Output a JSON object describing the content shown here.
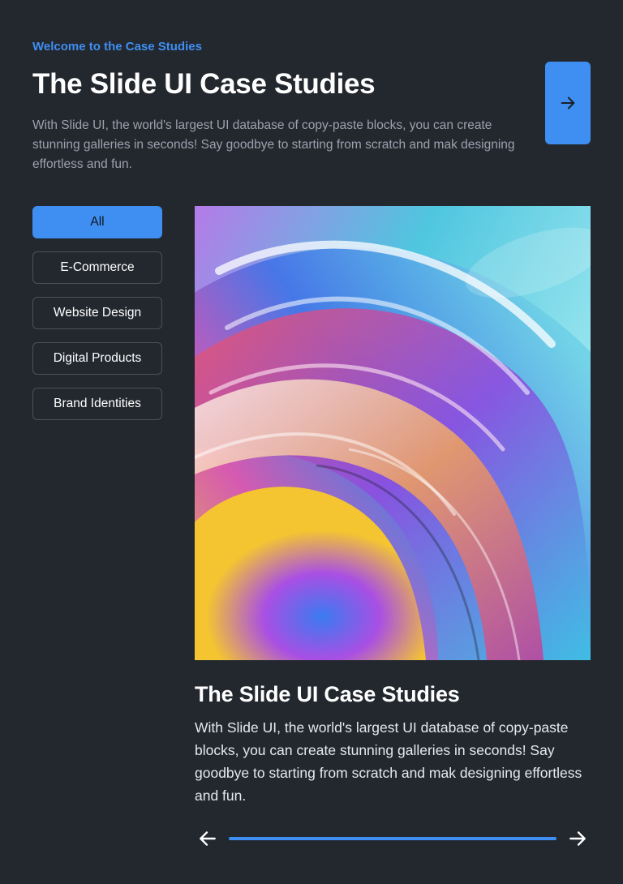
{
  "header": {
    "eyebrow": "Welcome to the Case Studies",
    "title": "The Slide UI Case Studies",
    "description": "With Slide UI, the world's largest UI database of copy-paste blocks, you can create stunning galleries in seconds! Say goodbye to starting from scratch and mak designing effortless and fun.",
    "next_icon": "arrow-right-icon"
  },
  "filters": {
    "items": [
      {
        "label": "All",
        "active": true
      },
      {
        "label": "E-Commerce",
        "active": false
      },
      {
        "label": "Website Design",
        "active": false
      },
      {
        "label": "Digital Products",
        "active": false
      },
      {
        "label": "Brand Identities",
        "active": false
      }
    ]
  },
  "card": {
    "title": "The Slide UI Case Studies",
    "description": "With Slide UI, the world's largest UI database of copy-paste blocks, you can create stunning galleries in seconds! Say goodbye to starting from scratch and mak designing effortless and fun."
  },
  "pager": {
    "prev_icon": "arrow-left-icon",
    "next_icon": "arrow-right-icon",
    "progress": 1.0
  },
  "colors": {
    "background": "#23282f",
    "accent": "#3f8ef1",
    "muted_text": "#9aa2ad"
  }
}
